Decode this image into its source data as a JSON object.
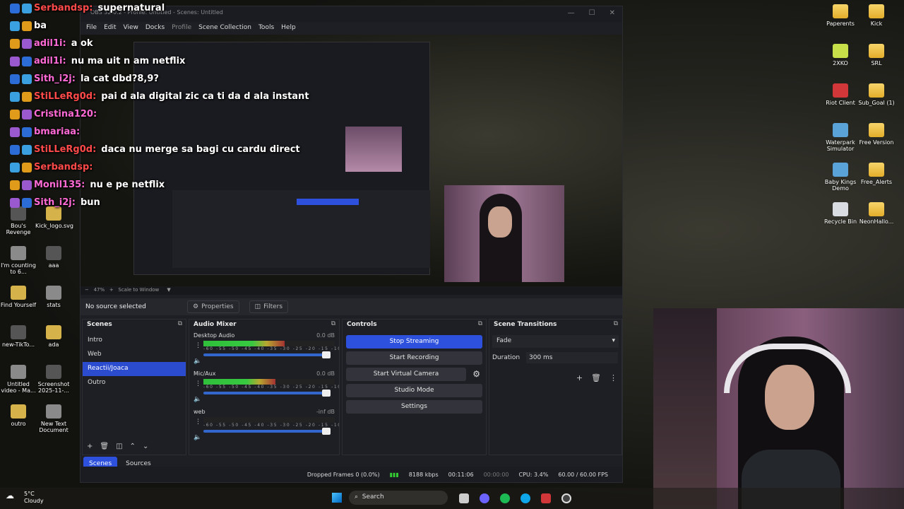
{
  "desktop_icons": [
    {
      "label": "Paperents",
      "icon": "folder-icon"
    },
    {
      "label": "Kick",
      "icon": "folder-icon"
    },
    {
      "label": "2XKO",
      "icon": "app-icon"
    },
    {
      "label": "SRL",
      "icon": "folder-icon"
    },
    {
      "label": "Riot Client",
      "icon": "riot-icon"
    },
    {
      "label": "Sub_Goal (1)",
      "icon": "folder-icon"
    },
    {
      "label": "Waterpark Simulator",
      "icon": "game-icon"
    },
    {
      "label": "Free Version",
      "icon": "folder-icon"
    },
    {
      "label": "Baby Kings Demo",
      "icon": "game-icon"
    },
    {
      "label": "Free_Alerts",
      "icon": "folder-icon"
    },
    {
      "label": "Recycle Bin",
      "icon": "recycle-bin-icon"
    },
    {
      "label": "NeonHallo...",
      "icon": "folder-icon"
    }
  ],
  "left_icons": [
    {
      "label": "Bou's Revenge"
    },
    {
      "label": "Kick_logo.svg"
    },
    {
      "label": "I'm counting to 6..."
    },
    {
      "label": "aaa"
    },
    {
      "label": "Find Yourself"
    },
    {
      "label": "stats"
    },
    {
      "label": "new-TikTo..."
    },
    {
      "label": "ada"
    },
    {
      "label": "Untitled video - Ma..."
    },
    {
      "label": "Screenshot 2025-11-..."
    },
    {
      "label": "outro"
    },
    {
      "label": "New Text Document"
    }
  ],
  "chat": [
    {
      "user": "Serbandsp:",
      "msg": "supernatural",
      "color": "#ff4a4a"
    },
    {
      "user": "ba",
      "msg": "",
      "color": "#ffffff"
    },
    {
      "user": "adil1i:",
      "msg": "a ok",
      "color": "#ff6ad5"
    },
    {
      "user": "adil1i:",
      "msg": "nu ma uit n am netflix",
      "color": "#ff6ad5"
    },
    {
      "user": "Sith_i2j:",
      "msg": "la cat dbd?8,9?",
      "color": "#ff6ad5"
    },
    {
      "user": "StiLLeRg0d:",
      "msg": "pai d ala digital zic ca ti da d ala instant",
      "color": "#ff4a4a"
    },
    {
      "user": "Cristina120:",
      "msg": "",
      "color": "#ff6ad5"
    },
    {
      "user": "bmariaa:",
      "msg": "",
      "color": "#ff6ad5"
    },
    {
      "user": "StiLLeRg0d:",
      "msg": "daca nu merge sa bagi cu cardu direct",
      "color": "#ff4a4a"
    },
    {
      "user": "Serbandsp:",
      "msg": "",
      "color": "#ff4a4a"
    },
    {
      "user": "Monil135:",
      "msg": "nu e pe netflix",
      "color": "#ff6ad5"
    },
    {
      "user": "Sith_i2j:",
      "msg": "bun",
      "color": "#ff6ad5"
    }
  ],
  "obs": {
    "title": "OBS 32.0.2 - Profile: Untitled - Scenes: Untitled",
    "menu": [
      "File",
      "Edit",
      "View",
      "Docks",
      "Profile",
      "Scene Collection",
      "Tools",
      "Help"
    ],
    "zoom": "47%",
    "scale": "Scale to Window",
    "no_source": "No source selected",
    "properties": "Properties",
    "filters": "Filters",
    "scenes_title": "Scenes",
    "scenes": [
      "Intro",
      "Web",
      "Reactii/Joaca",
      "Outro"
    ],
    "selected_scene": "Reactii/Joaca",
    "tab_scenes": "Scenes",
    "tab_sources": "Sources",
    "mixer_title": "Audio Mixer",
    "channels": [
      {
        "name": "Desktop Audio",
        "db": "0.0 dB",
        "level": 0.62
      },
      {
        "name": "Mic/Aux",
        "db": "0.0 dB",
        "level": 0.55
      },
      {
        "name": "web",
        "db": "-inf dB",
        "level": 0
      }
    ],
    "meter_scale": "-60 -55 -50 -45 -40 -35 -30 -25 -20 -15 -10 -5 0",
    "controls_title": "Controls",
    "controls": {
      "stop_streaming": "Stop Streaming",
      "start_recording": "Start Recording",
      "start_virtual_camera": "Start Virtual Camera",
      "studio_mode": "Studio Mode",
      "settings": "Settings"
    },
    "transitions_title": "Scene Transitions",
    "transition": "Fade",
    "duration_label": "Duration",
    "duration": "300 ms",
    "status": {
      "dropped": "Dropped Frames 0 (0.0%)",
      "kbps": "8188 kbps",
      "live": "00:11:06",
      "rec": "00:00:00",
      "cpu": "CPU: 3.4%",
      "fps": "60.00 / 60.00 FPS"
    }
  },
  "weather": {
    "temp": "5°C",
    "desc": "Cloudy"
  },
  "taskbar": {
    "search": "Search"
  }
}
